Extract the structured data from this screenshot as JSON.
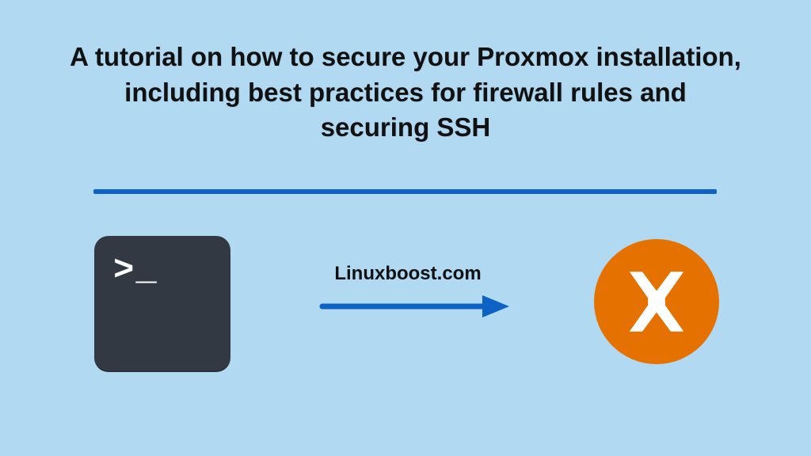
{
  "title": "A tutorial on how to secure your Proxmox installation, including best practices for firewall rules and securing SSH",
  "terminal": {
    "prompt": ">_"
  },
  "site_label": "Linuxboost.com",
  "colors": {
    "background": "#b1d9f2",
    "divider": "#0c62c5",
    "terminal_bg": "#323943",
    "arrow": "#0c62c5",
    "proxmox_bg": "#e57200",
    "proxmox_x": "#ffffff"
  }
}
